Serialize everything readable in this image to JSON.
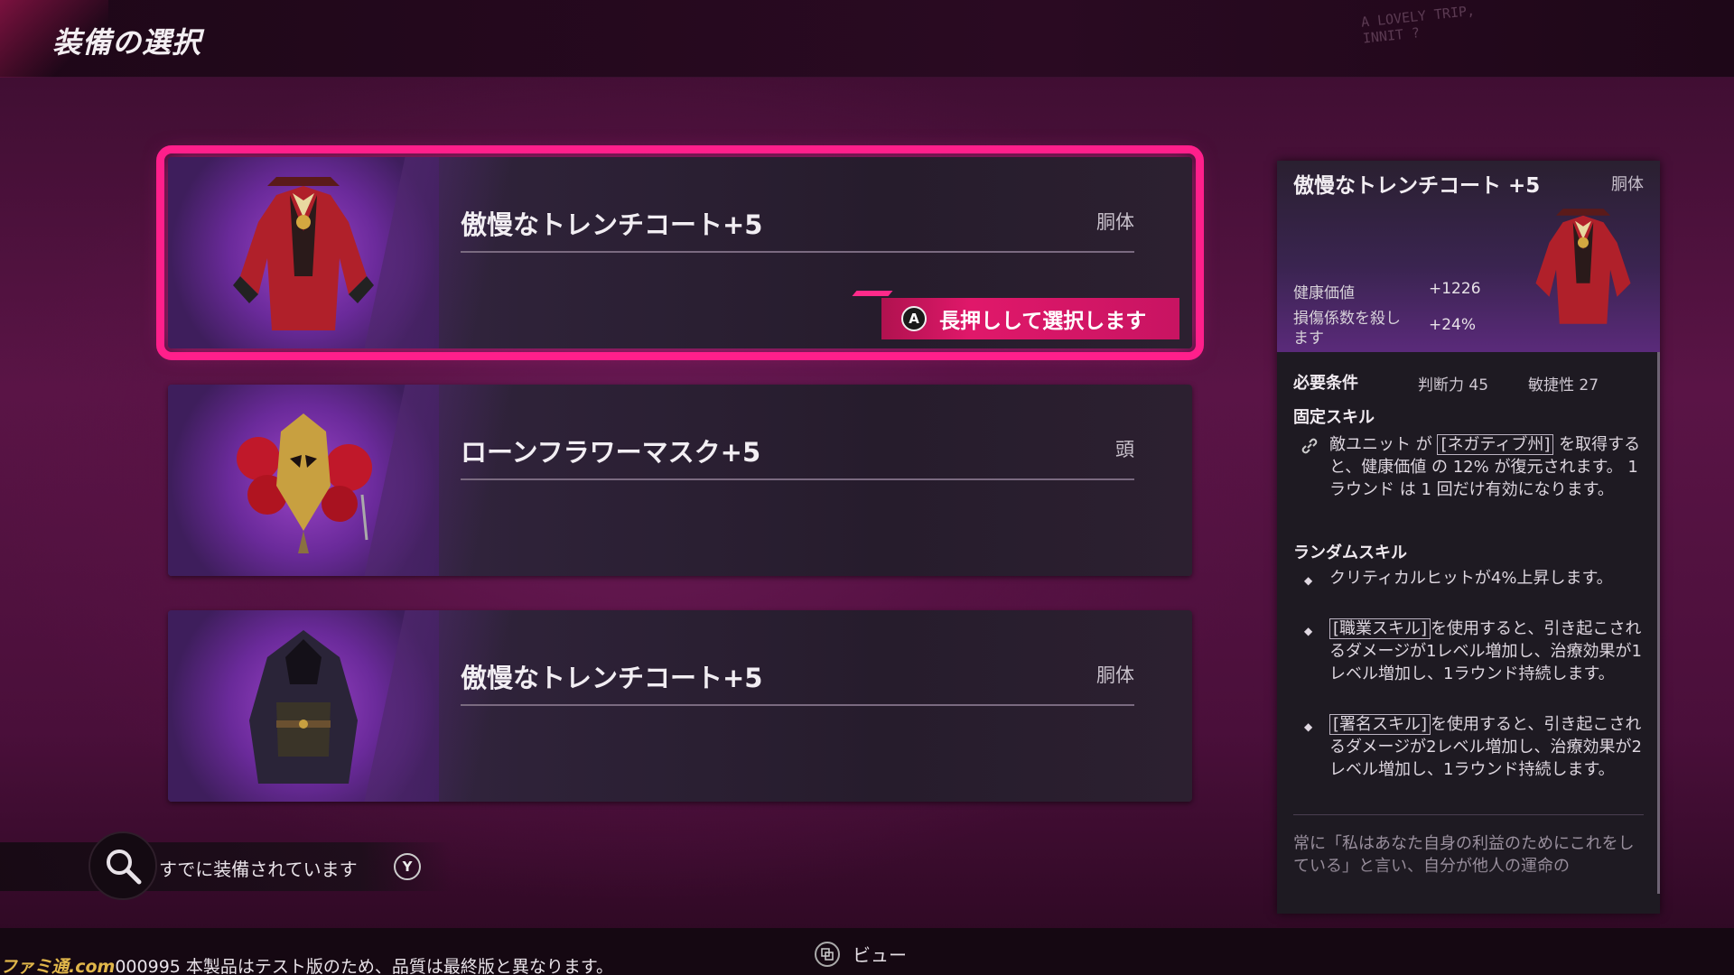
{
  "header": {
    "title": "装備の選択",
    "corner_note": "A LOVELY TRIP,\nINNIT ?"
  },
  "equipment_list": [
    {
      "name": "傲慢なトレンチコート+5",
      "slot": "胴体",
      "selected": true
    },
    {
      "name": "ローンフラワーマスク+5",
      "slot": "頭",
      "selected": false
    },
    {
      "name": "傲慢なトレンチコート+5",
      "slot": "胴体",
      "selected": false
    }
  ],
  "hold_select": {
    "button": "A",
    "label": "長押しして選択します"
  },
  "equipped_filter": {
    "label": "すでに装備されています",
    "button": "Y"
  },
  "detail": {
    "name": "傲慢なトレンチコート +5",
    "slot": "胴体",
    "stats": [
      {
        "label": "健康価値",
        "value": "+1226"
      },
      {
        "label": "損傷係数を殺し",
        "label2": "ます",
        "value": "+24%"
      }
    ],
    "requirements": {
      "title": "必要条件",
      "values": [
        "判断力 45",
        "敏捷性 27"
      ]
    },
    "fixed_skill": {
      "title": "固定スキル",
      "pre": "敵ユニット が ",
      "tag": "[ネガティブ州]",
      "post": " を取得すると、健康価値 の 12% が復元されます。 1ラウンド は 1 回だけ有効になります。"
    },
    "random_skill": {
      "title": "ランダムスキル",
      "items": [
        {
          "tag": "",
          "text": "クリティカルヒットが4%上昇します。"
        },
        {
          "tag": "[職業スキル]",
          "text": "を使用すると、引き起こされるダメージが1レベル増加し、治療効果が1レベル増加し、1ラウンド持続します。"
        },
        {
          "tag": "[署名スキル]",
          "text": "を使用すると、引き起こされるダメージが2レベル増加し、治療効果が2レベル増加し、1ラウンド持続します。"
        }
      ]
    },
    "flavor": "常に「私はあなた自身の利益のためにこれをしている」と言い、自分が他人の運命の"
  },
  "footer": {
    "view_label": "ビュー",
    "notice_logo": "ファミ通.com",
    "notice": "000995 本製品はテスト版のため、品質は最終版と異なります。"
  },
  "colors": {
    "accent": "#ff1f8b",
    "button": "#e0186a",
    "panel": "#1e1a22"
  }
}
